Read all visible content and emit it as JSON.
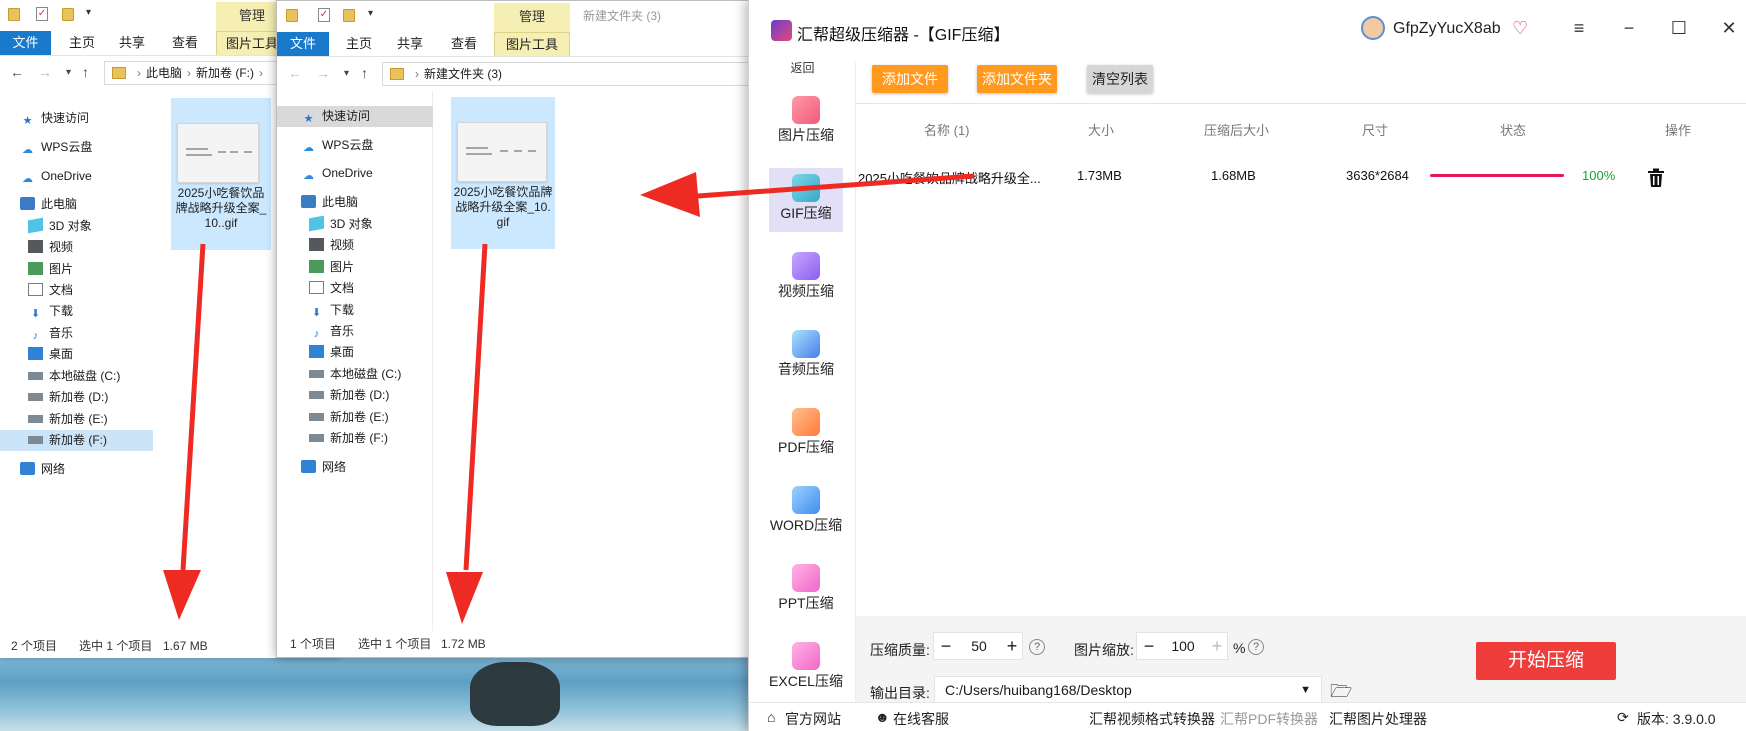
{
  "explorer_left": {
    "ribbon": {
      "manage": "管理",
      "tab_file": "文件",
      "tab_home": "主页",
      "tab_share": "共享",
      "tab_view": "查看",
      "tab_picture_tools": "图片工具"
    },
    "breadcrumb": [
      "此电脑",
      "新加卷 (F:)"
    ],
    "nav": [
      "快速访问",
      "WPS云盘",
      "OneDrive",
      "此电脑",
      "3D 对象",
      "视频",
      "图片",
      "文档",
      "下载",
      "音乐",
      "桌面",
      "本地磁盘 (C:)",
      "新加卷 (D:)",
      "新加卷 (E:)",
      "新加卷 (F:)",
      "网络"
    ],
    "file_name": "2025小吃餐饮品牌战略升级全案_10..gif",
    "status": {
      "items": "2 个项目",
      "selected": "选中 1 个项目",
      "size": "1.67 MB"
    }
  },
  "explorer_right": {
    "window_title": "新建文件夹 (3)",
    "ribbon": {
      "manage": "管理",
      "tab_file": "文件",
      "tab_home": "主页",
      "tab_share": "共享",
      "tab_view": "查看",
      "tab_picture_tools": "图片工具"
    },
    "breadcrumb": [
      "新建文件夹 (3)"
    ],
    "nav": [
      "快速访问",
      "WPS云盘",
      "OneDrive",
      "此电脑",
      "3D 对象",
      "视频",
      "图片",
      "文档",
      "下载",
      "音乐",
      "桌面",
      "本地磁盘 (C:)",
      "新加卷 (D:)",
      "新加卷 (E:)",
      "新加卷 (F:)",
      "网络"
    ],
    "file_name": "2025小吃餐饮品牌战略升级全案_10.gif",
    "status": {
      "items": "1 个项目",
      "selected": "选中 1 个项目",
      "size": "1.72 MB"
    }
  },
  "app": {
    "title": "汇帮超级压缩器  -【GIF压缩】",
    "user": "GfpZyYucX8ab",
    "back": "返回",
    "nav": [
      "图片压缩",
      "GIF压缩",
      "视频压缩",
      "音频压缩",
      "PDF压缩",
      "WORD压缩",
      "PPT压缩",
      "EXCEL压缩"
    ],
    "nav_active": "GIF压缩",
    "toolbar": {
      "add_file": "添加文件",
      "add_folder": "添加文件夹",
      "clear": "清空列表"
    },
    "table": {
      "headers": [
        "名称 (1)",
        "大小",
        "压缩后大小",
        "尺寸",
        "状态",
        "操作"
      ],
      "rows": [
        {
          "name": "2025小吃餐饮品牌战略升级全...",
          "size": "1.73MB",
          "compressed": "1.68MB",
          "dims": "3636*2684",
          "progress": 1.0,
          "status": "100%"
        }
      ]
    },
    "settings": {
      "quality_label": "压缩质量:",
      "quality": "50",
      "scale_label": "图片缩放:",
      "scale": "100",
      "scale_unit": "%",
      "output_label": "输出目录:",
      "output_path": "C:/Users/huibang168/Desktop"
    },
    "start": "开始压缩",
    "footer": {
      "site": "官方网站",
      "service": "在线客服",
      "video_conv": "汇帮视频格式转换器",
      "pdf_conv": "汇帮PDF转换器",
      "img_proc": "汇帮图片处理器",
      "version": "版本: 3.9.0.0"
    }
  },
  "colors": {
    "accent_orange": "#ff9a1e",
    "start_red": "#ef3d3b",
    "progress": "#e2195a",
    "annotation_arrow": "#ee2b22",
    "explorer_blue": "#1979ca"
  }
}
